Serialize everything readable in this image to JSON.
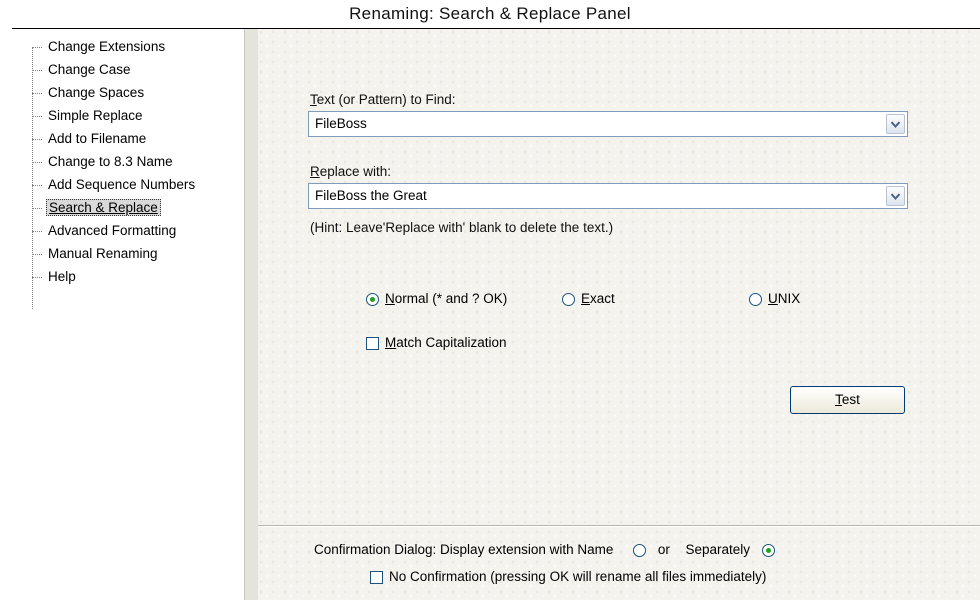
{
  "title": "Renaming: Search & Replace Panel",
  "tree": {
    "items": [
      {
        "label": "Change Extensions"
      },
      {
        "label": "Change Case"
      },
      {
        "label": "Change Spaces"
      },
      {
        "label": "Simple Replace"
      },
      {
        "label": "Add to Filename"
      },
      {
        "label": "Change to 8.3 Name"
      },
      {
        "label": "Add Sequence Numbers"
      },
      {
        "label": "Search & Replace",
        "selected": true
      },
      {
        "label": "Advanced Formatting"
      },
      {
        "label": "Manual Renaming"
      },
      {
        "label": "Help"
      }
    ]
  },
  "find": {
    "label_accel": "T",
    "label_rest": "ext (or Pattern) to Find:",
    "value": "FileBoss"
  },
  "replace": {
    "label_accel": "R",
    "label_rest": "eplace with:",
    "value": "FileBoss the Great"
  },
  "hint": "(Hint:  Leave'Replace with' blank to delete the text.)",
  "modes": [
    {
      "accel": "N",
      "rest": "ormal (* and ? OK)",
      "selected": true
    },
    {
      "accel": "E",
      "rest": "xact",
      "selected": false
    },
    {
      "accel": "U",
      "rest": "NIX",
      "selected": false
    }
  ],
  "match_case": {
    "accel": "M",
    "rest": "atch Capitalization",
    "checked": false
  },
  "test_button": {
    "accel": "T",
    "rest": "est"
  },
  "confirmation": {
    "prefix": "Confirmation Dialog: Display extension with Name",
    "or": "or",
    "separately": "Separately",
    "name_selected": false,
    "separately_selected": true,
    "no_confirm_label": "No Confirmation (pressing OK will rename all files immediately)",
    "no_confirm_checked": false
  },
  "colors": {
    "radio_selected_dot": "#21a121",
    "control_border": "#1c5180",
    "combo_border": "#7f9db9",
    "panel_bg": "#f4f3ee"
  },
  "icons": {
    "combo_drop": "chevron-down-icon"
  }
}
